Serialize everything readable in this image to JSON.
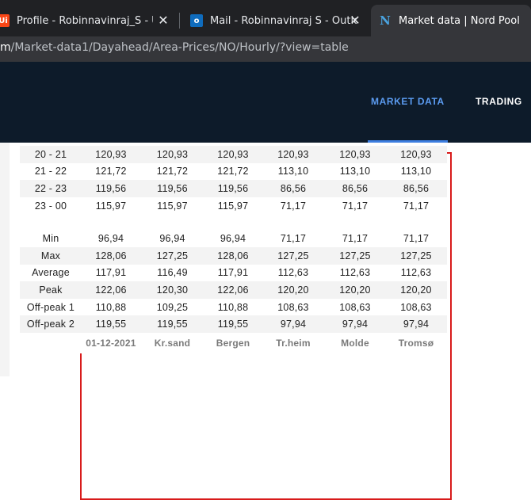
{
  "browser": {
    "tabs": [
      {
        "title": "Profile - Robinnavinraj_S - UiPath",
        "icon": "uipath-icon",
        "icon_text": "Ui",
        "icon_color": "#fa4616"
      },
      {
        "title": "Mail - Robinnavinraj S - Outlook",
        "icon": "outlook-icon",
        "icon_text": "o",
        "icon_color": "#0f6cbd"
      },
      {
        "title": "Market data | Nord Pool",
        "icon": "nordpool-icon",
        "icon_text": "N",
        "icon_color": "#00263e"
      }
    ],
    "close_glyph": "✕",
    "url": {
      "host": "m",
      "path": "/Market-data1/Dayahead/Area-Prices/NO/Hourly/?view=table"
    }
  },
  "site_nav": {
    "market_data": "MARKET DATA",
    "trading": "TRADING"
  },
  "table": {
    "rows": [
      {
        "label": "20 - 21",
        "values": [
          "120,93",
          "120,93",
          "120,93",
          "120,93",
          "120,93",
          "120,93"
        ]
      },
      {
        "label": "21 - 22",
        "values": [
          "121,72",
          "121,72",
          "121,72",
          "113,10",
          "113,10",
          "113,10"
        ]
      },
      {
        "label": "22 - 23",
        "values": [
          "119,56",
          "119,56",
          "119,56",
          "86,56",
          "86,56",
          "86,56"
        ]
      },
      {
        "label": "23 - 00",
        "values": [
          "115,97",
          "115,97",
          "115,97",
          "71,17",
          "71,17",
          "71,17"
        ]
      }
    ],
    "stats": [
      {
        "label": "Min",
        "values": [
          "96,94",
          "96,94",
          "96,94",
          "71,17",
          "71,17",
          "71,17"
        ]
      },
      {
        "label": "Max",
        "values": [
          "128,06",
          "127,25",
          "128,06",
          "127,25",
          "127,25",
          "127,25"
        ]
      },
      {
        "label": "Average",
        "values": [
          "117,91",
          "116,49",
          "117,91",
          "112,63",
          "112,63",
          "112,63"
        ]
      },
      {
        "label": "Peak",
        "values": [
          "122,06",
          "120,30",
          "122,06",
          "120,20",
          "120,20",
          "120,20"
        ]
      },
      {
        "label": "Off-peak 1",
        "values": [
          "110,88",
          "109,25",
          "110,88",
          "108,63",
          "108,63",
          "108,63"
        ]
      },
      {
        "label": "Off-peak 2",
        "values": [
          "119,55",
          "119,55",
          "119,55",
          "97,94",
          "97,94",
          "97,94"
        ]
      }
    ],
    "footer": [
      "",
      "01-12-2021",
      "Kr.sand",
      "Bergen",
      "Tr.heim",
      "Molde",
      "Tromsø"
    ]
  },
  "colors": {
    "nav_bg": "#0d1b2a",
    "active_link": "#5b9bf0",
    "highlight_box": "#d81b1b"
  }
}
